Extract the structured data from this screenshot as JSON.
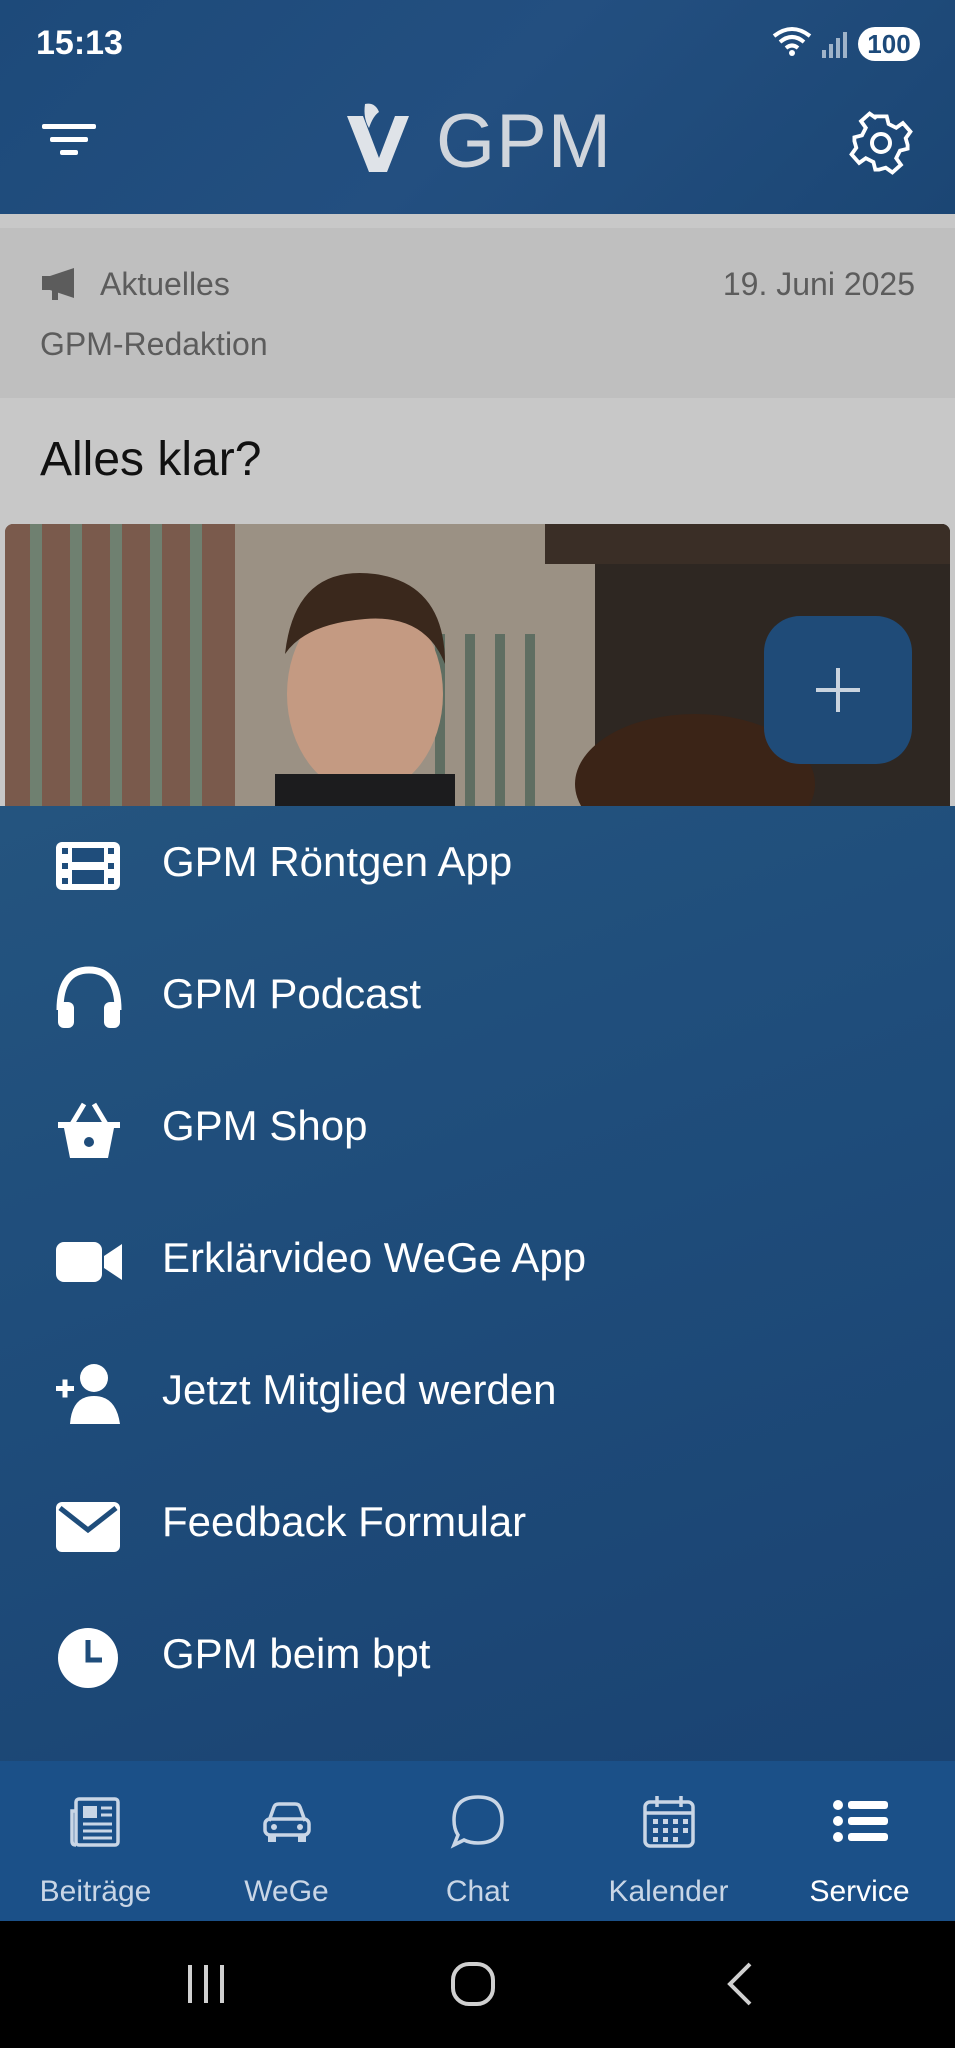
{
  "status_bar": {
    "time": "15:13",
    "battery": "100"
  },
  "header": {
    "logo_text": "GPM"
  },
  "post": {
    "category": "Aktuelles",
    "date": "19. Juni 2025",
    "author": "GPM-Redaktion",
    "title": "Alles klar?"
  },
  "menu": {
    "items": [
      {
        "label": "GPM Röntgen App",
        "icon": "film-icon"
      },
      {
        "label": "GPM Podcast",
        "icon": "headphones-icon"
      },
      {
        "label": "GPM Shop",
        "icon": "basket-icon"
      },
      {
        "label": "Erklärvideo WeGe App",
        "icon": "video-camera-icon"
      },
      {
        "label": "Jetzt Mitglied werden",
        "icon": "add-user-icon"
      },
      {
        "label": "Feedback Formular",
        "icon": "envelope-icon"
      },
      {
        "label": "GPM beim bpt",
        "icon": "clock-icon"
      }
    ]
  },
  "tabs": [
    {
      "label": "Beiträge",
      "icon": "newspaper-icon"
    },
    {
      "label": "WeGe",
      "icon": "car-icon"
    },
    {
      "label": "Chat",
      "icon": "chat-bubble-icon"
    },
    {
      "label": "Kalender",
      "icon": "calendar-icon"
    },
    {
      "label": "Service",
      "icon": "list-icon",
      "active": true
    }
  ],
  "colors": {
    "primary": "#1f4b78",
    "tabbar": "#1b5088",
    "text_on_primary": "#ffffff"
  }
}
